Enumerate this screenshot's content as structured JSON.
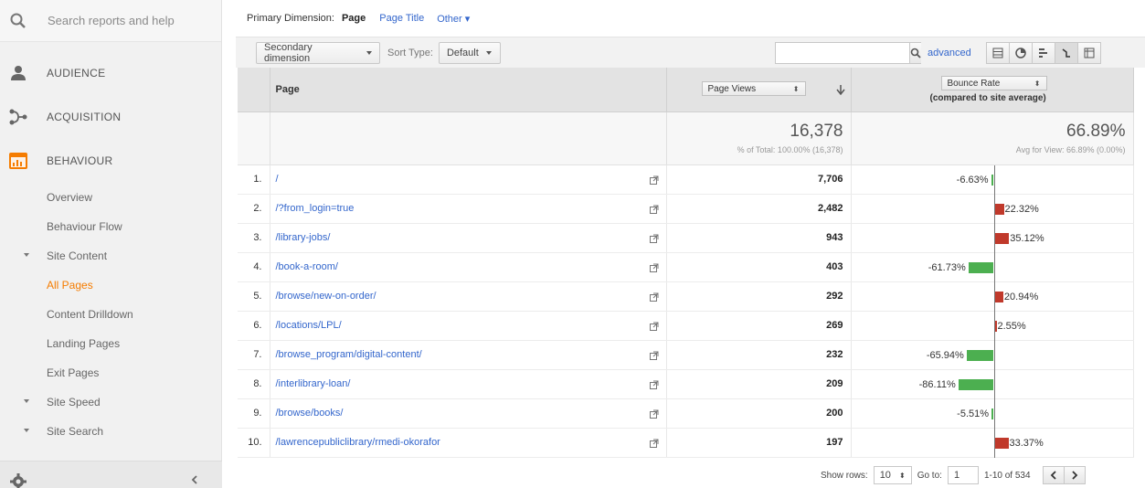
{
  "sidebar": {
    "search_placeholder": "Search reports and help",
    "nav": [
      {
        "label": "AUDIENCE",
        "icon": "person-icon"
      },
      {
        "label": "ACQUISITION",
        "icon": "acquisition-icon"
      },
      {
        "label": "BEHAVIOUR",
        "icon": "behaviour-icon",
        "color": "#f57c00"
      }
    ],
    "sub": [
      {
        "label": "Overview"
      },
      {
        "label": "Behaviour Flow"
      },
      {
        "label": "Site Content"
      },
      {
        "label": "All Pages"
      },
      {
        "label": "Content Drilldown"
      },
      {
        "label": "Landing Pages"
      },
      {
        "label": "Exit Pages"
      },
      {
        "label": "Site Speed"
      },
      {
        "label": "Site Search"
      }
    ]
  },
  "dimension": {
    "label": "Primary Dimension:",
    "selected": "Page",
    "alt1": "Page Title",
    "alt2": "Other"
  },
  "toolbar": {
    "secondary": "Secondary dimension",
    "sort_label": "Sort Type:",
    "sort_value": "Default",
    "search_value": "",
    "advanced": "advanced"
  },
  "table": {
    "col_page": "Page",
    "col_views": "Page Views",
    "col_bounce": "Bounce Rate",
    "col_bounce_sub": "(compared to site average)",
    "totals": {
      "views": "16,378",
      "views_sub": "% of Total: 100.00% (16,378)",
      "bounce": "66.89%",
      "bounce_sub": "Avg for View: 66.89% (0.00%)"
    },
    "rows": [
      {
        "n": "1.",
        "page": "/",
        "views": "7,706",
        "delta": -6.63,
        "label": "-6.63%"
      },
      {
        "n": "2.",
        "page": "/?from_login=true",
        "views": "2,482",
        "delta": 22.32,
        "label": "22.32%"
      },
      {
        "n": "3.",
        "page": "/library-jobs/",
        "views": "943",
        "delta": 35.12,
        "label": "35.12%"
      },
      {
        "n": "4.",
        "page": "/book-a-room/",
        "views": "403",
        "delta": -61.73,
        "label": "-61.73%"
      },
      {
        "n": "5.",
        "page": "/browse/new-on-order/",
        "views": "292",
        "delta": 20.94,
        "label": "20.94%"
      },
      {
        "n": "6.",
        "page": "/locations/LPL/",
        "views": "269",
        "delta": 2.55,
        "label": "2.55%"
      },
      {
        "n": "7.",
        "page": "/browse_program/digital-content/",
        "views": "232",
        "delta": -65.94,
        "label": "-65.94%"
      },
      {
        "n": "8.",
        "page": "/interlibrary-loan/",
        "views": "209",
        "delta": -86.11,
        "label": "-86.11%"
      },
      {
        "n": "9.",
        "page": "/browse/books/",
        "views": "200",
        "delta": -5.51,
        "label": "-5.51%"
      },
      {
        "n": "10.",
        "page": "/lawrencepubliclibrary/rmedi-okorafor",
        "views": "197",
        "delta": 33.37,
        "label": "33.37%"
      }
    ]
  },
  "footer": {
    "show_rows": "Show rows:",
    "rows_value": "10",
    "goto": "Go to:",
    "goto_value": "1",
    "range": "1-10 of 534"
  }
}
